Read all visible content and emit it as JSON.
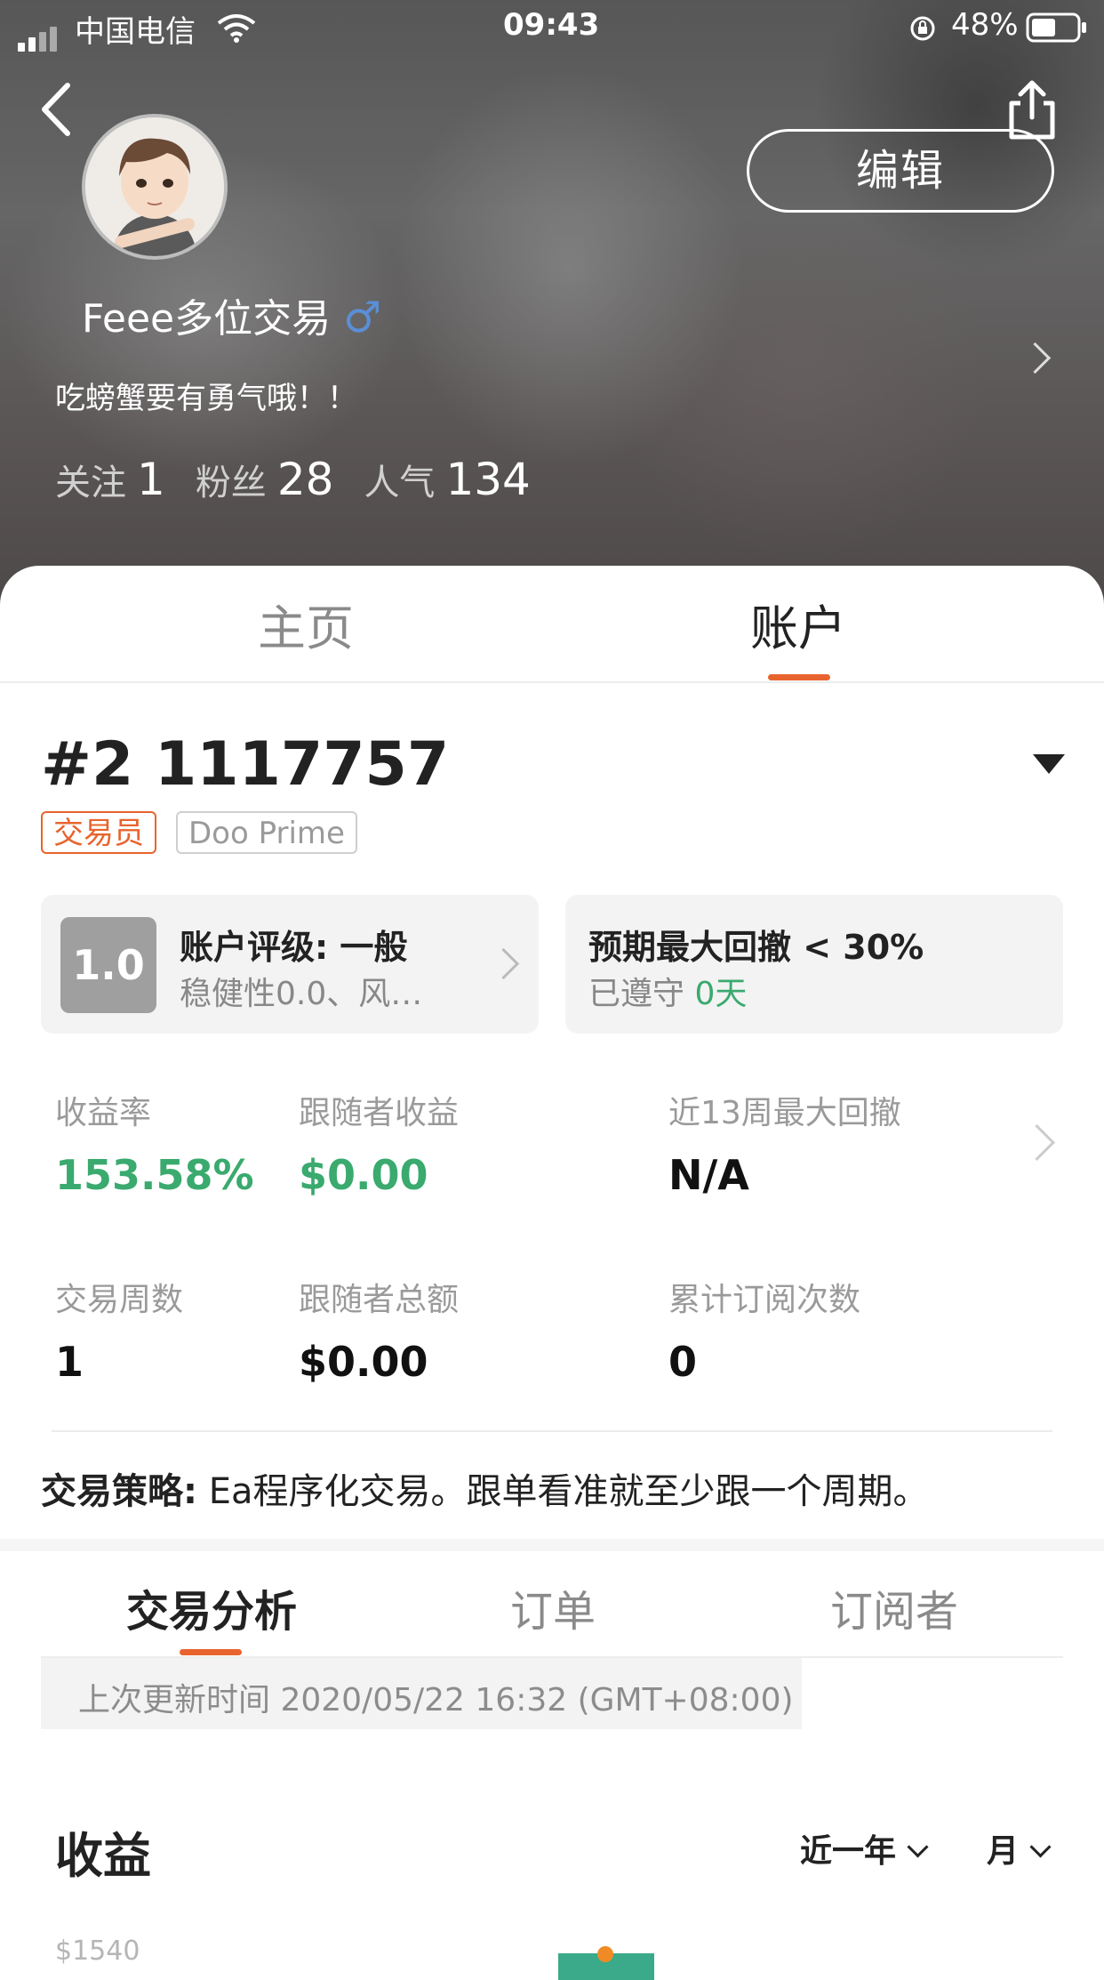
{
  "status_bar": {
    "carrier": "中国电信",
    "time": "09:43",
    "battery": "48%"
  },
  "header": {
    "edit_label": "编辑",
    "nickname": "Feee多位交易",
    "gender_symbol": "♂",
    "bio": "吃螃蟹要有勇气哦！！",
    "stats": [
      {
        "label": "关注",
        "value": "1"
      },
      {
        "label": "粉丝",
        "value": "28"
      },
      {
        "label": "人气",
        "value": "134"
      }
    ]
  },
  "tabs": {
    "home": "主页",
    "account": "账户"
  },
  "account": {
    "number": "#2 1117757",
    "tag_role": "交易员",
    "tag_broker": "Doo Prime",
    "rating": {
      "score": "1.0",
      "title": "账户评级: 一般",
      "detail": "稳健性0.0、风…"
    },
    "drawdown_card": {
      "title": "预期最大回撤 < 30%",
      "kept_prefix": "已遵守",
      "kept_value": "0天"
    },
    "metrics": {
      "return_rate_label": "收益率",
      "return_rate_value": "153.58%",
      "follower_profit_label": "跟随者收益",
      "follower_profit_value": "$0.00",
      "max_drawdown_label": "近13周最大回撤",
      "max_drawdown_value": "N/A",
      "weeks_label": "交易周数",
      "weeks_value": "1",
      "follower_total_label": "跟随者总额",
      "follower_total_value": "$0.00",
      "subscriptions_label": "累计订阅次数",
      "subscriptions_value": "0"
    },
    "strategy_label": "交易策略:",
    "strategy_text": " Ea程序化交易。跟单看准就至少跟一个周期。"
  },
  "sub_tabs": {
    "analysis": "交易分析",
    "orders": "订单",
    "subscribers": "订阅者"
  },
  "update_text": "上次更新时间 2020/05/22 16:32 (GMT+08:00)",
  "profit_section": {
    "title": "收益",
    "range_select": "近一年",
    "period_select": "月",
    "y_tick_top": "$1540"
  },
  "colors": {
    "accent": "#e8642e",
    "positive": "#3aaa6e",
    "bar": "#3aaa8a",
    "marker": "#f08a24"
  }
}
